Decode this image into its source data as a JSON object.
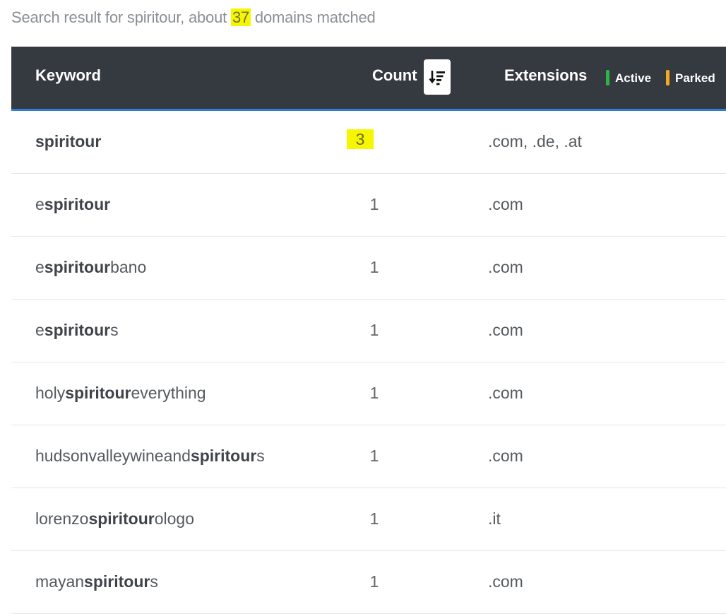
{
  "summary": {
    "prefix": "Search result for spiritour, about ",
    "count": "37",
    "suffix": " domains matched"
  },
  "header": {
    "keyword": "Keyword",
    "count": "Count",
    "sort_icon": "sort-descending-icon",
    "extensions": "Extensions",
    "legend_active": "Active",
    "legend_parked": "Parked",
    "colors": {
      "header_bg": "#343a40",
      "accent": "#2f7fd6",
      "active": "#2fb344",
      "parked": "#f5a623",
      "highlight": "#f6f600"
    }
  },
  "rows": [
    {
      "pre": "",
      "match": "spiritour",
      "post": "",
      "count": "3",
      "extensions": ".com, .de, .at",
      "highlight": true
    },
    {
      "pre": "e",
      "match": "spiritour",
      "post": "",
      "count": "1",
      "extensions": ".com"
    },
    {
      "pre": "e",
      "match": "spiritour",
      "post": "bano",
      "count": "1",
      "extensions": ".com"
    },
    {
      "pre": "e",
      "match": "spiritour",
      "post": "s",
      "count": "1",
      "extensions": ".com"
    },
    {
      "pre": "holy",
      "match": "spiritour",
      "post": "everything",
      "count": "1",
      "extensions": ".com"
    },
    {
      "pre": "hudsonvalleywineand",
      "match": "spiritour",
      "post": "s",
      "count": "1",
      "extensions": ".com"
    },
    {
      "pre": "lorenzo",
      "match": "spiritour",
      "post": "ologo",
      "count": "1",
      "extensions": ".it"
    },
    {
      "pre": "mayan",
      "match": "spiritour",
      "post": "s",
      "count": "1",
      "extensions": ".com"
    }
  ]
}
